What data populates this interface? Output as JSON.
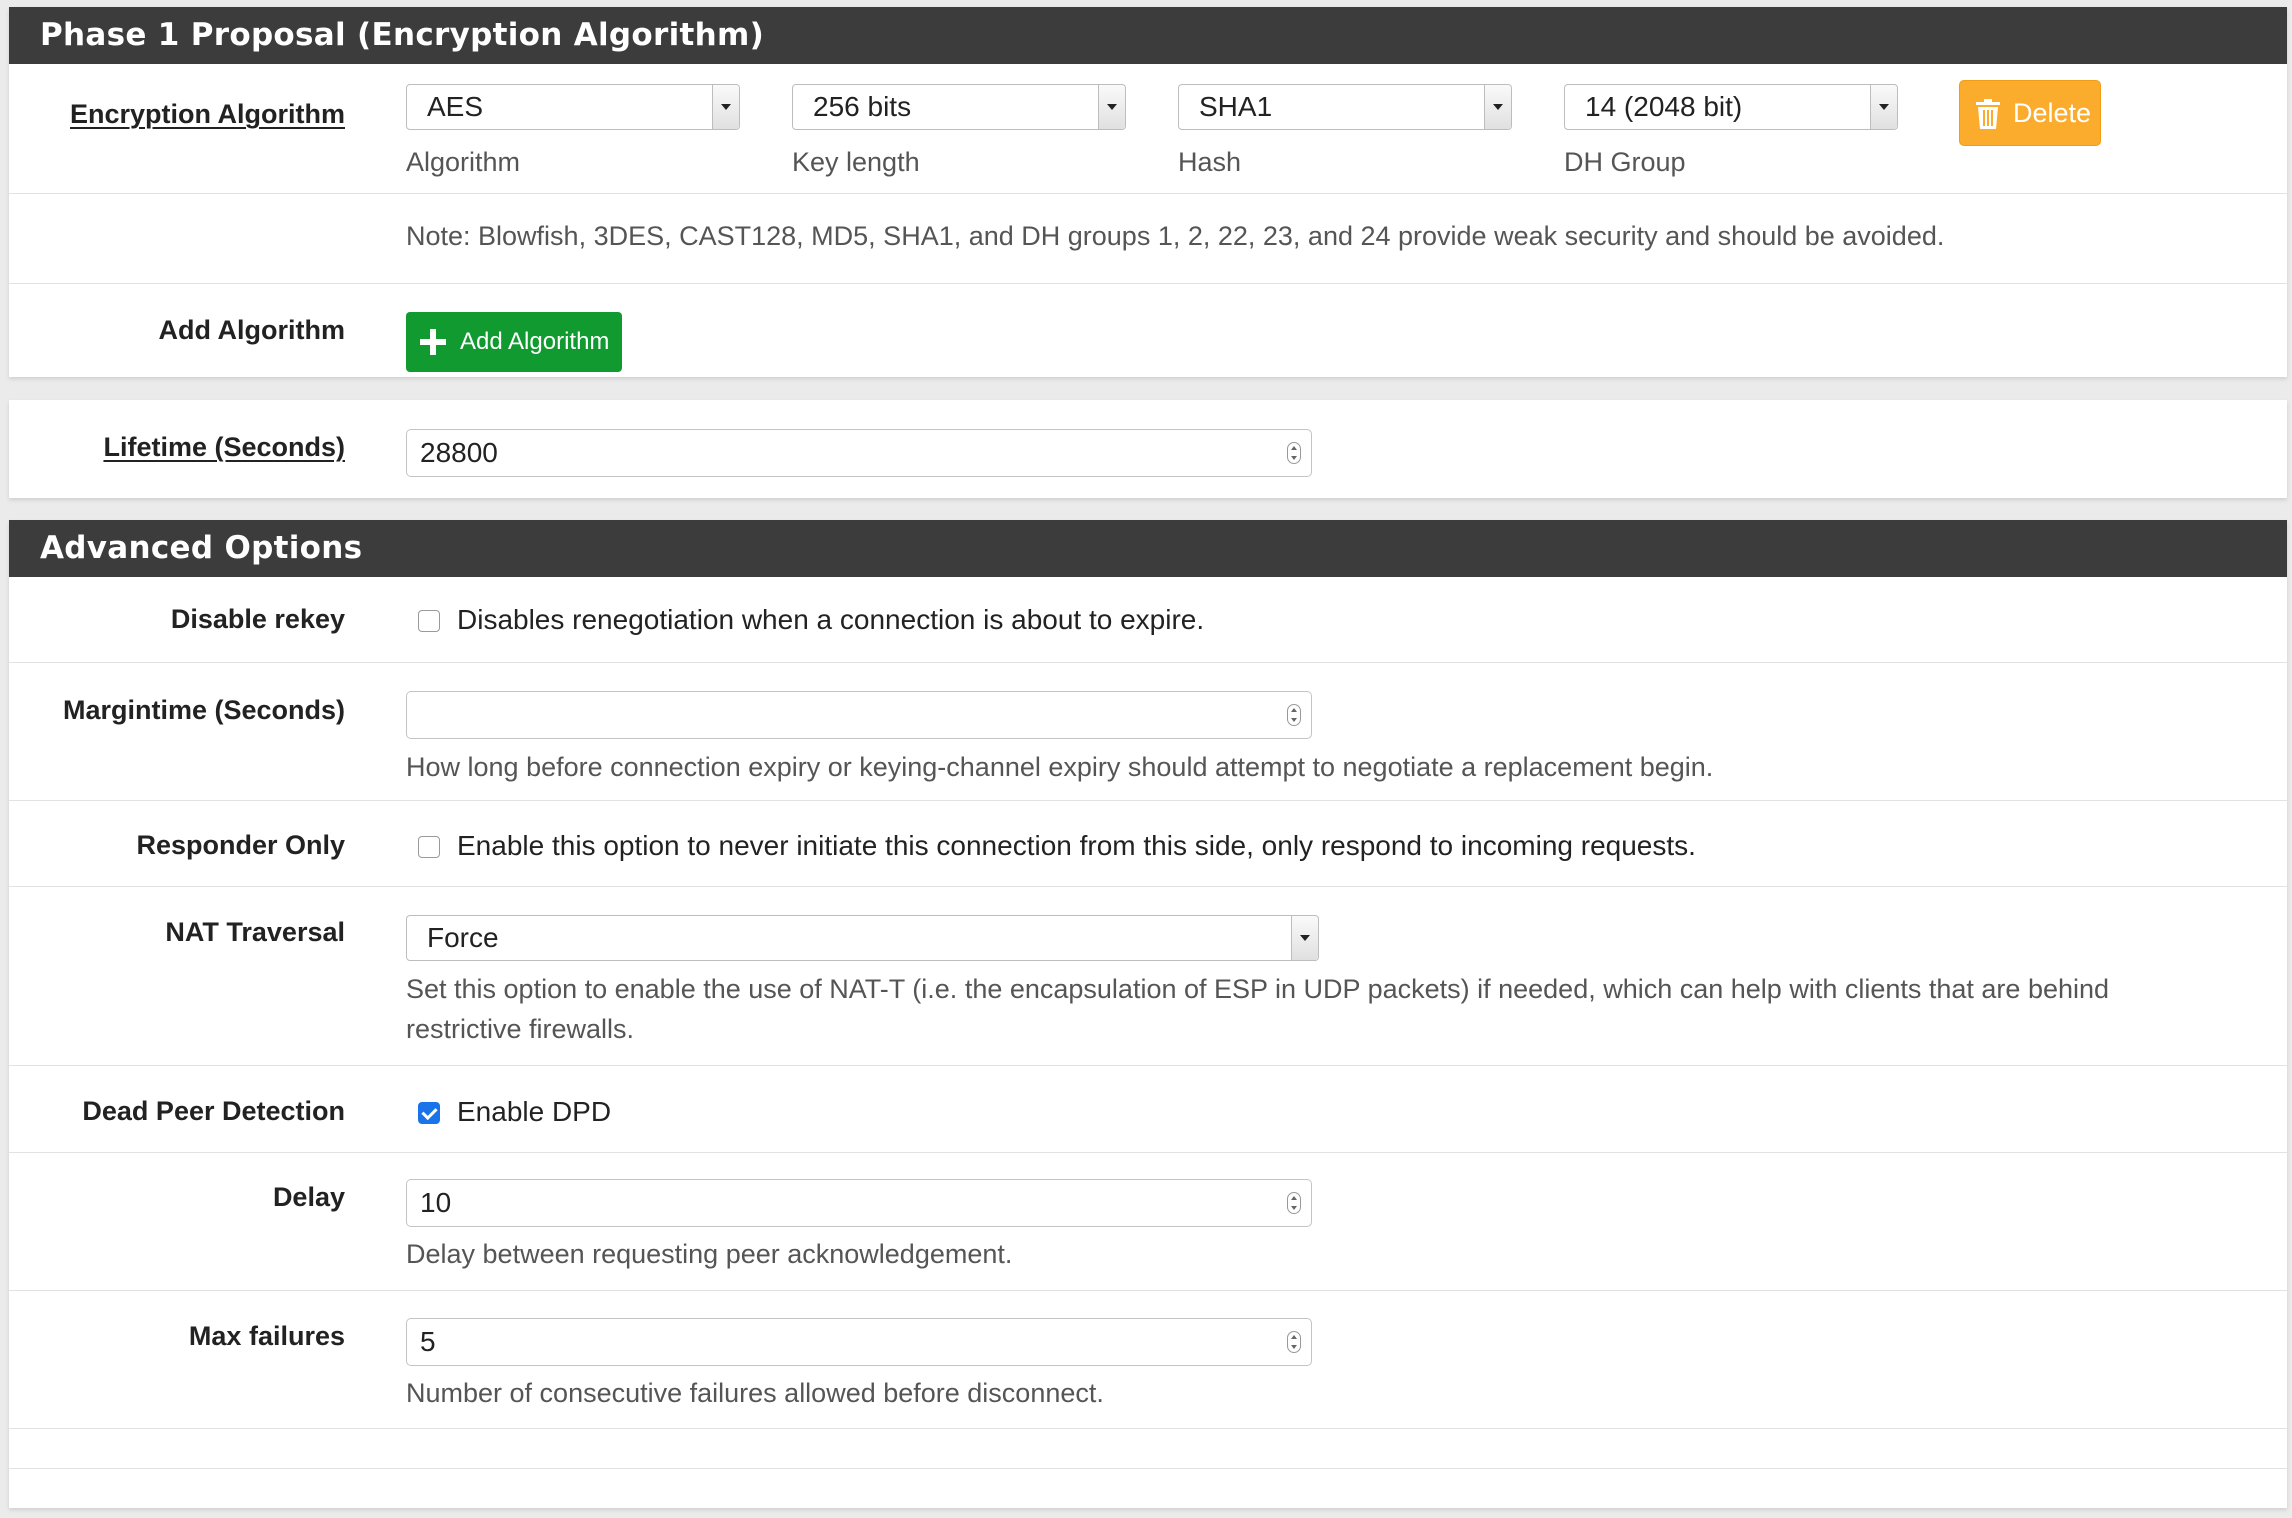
{
  "phase1": {
    "heading": "Phase 1 Proposal (Encryption Algorithm)",
    "encryption": {
      "label": "Encryption Algorithm",
      "algorithm": {
        "value": "AES",
        "caption": "Algorithm"
      },
      "key_length": {
        "value": "256 bits",
        "caption": "Key length"
      },
      "hash": {
        "value": "SHA1",
        "caption": "Hash"
      },
      "dh_group": {
        "value": "14 (2048 bit)",
        "caption": "DH Group"
      },
      "delete_label": "Delete"
    },
    "note": "Note: Blowfish, 3DES, CAST128, MD5, SHA1, and DH groups 1, 2, 22, 23, and 24 provide weak security and should be avoided.",
    "add": {
      "label": "Add Algorithm",
      "button_label": "Add Algorithm"
    }
  },
  "lifetime": {
    "label": "Lifetime (Seconds)",
    "value": "28800"
  },
  "advanced": {
    "heading": "Advanced Options",
    "disable_rekey": {
      "label": "Disable rekey",
      "checked": false,
      "text": "Disables renegotiation when a connection is about to expire."
    },
    "margintime": {
      "label": "Margintime (Seconds)",
      "value": "",
      "help": "How long before connection expiry or keying-channel expiry should attempt to negotiate a replacement begin."
    },
    "responder_only": {
      "label": "Responder Only",
      "checked": false,
      "text": "Enable this option to never initiate this connection from this side, only respond to incoming requests."
    },
    "nat_traversal": {
      "label": "NAT Traversal",
      "value": "Force",
      "help": "Set this option to enable the use of NAT-T (i.e. the encapsulation of ESP in UDP packets) if needed, which can help with clients that are behind restrictive firewalls."
    },
    "dpd": {
      "label": "Dead Peer Detection",
      "checked": true,
      "text": "Enable DPD"
    },
    "delay": {
      "label": "Delay",
      "value": "10",
      "help": "Delay between requesting peer acknowledgement."
    },
    "max_failures": {
      "label": "Max failures",
      "value": "5",
      "help": "Number of consecutive failures allowed before disconnect."
    }
  },
  "colors": {
    "heading_bg": "#3c3c3c",
    "delete_btn": "#fbac2c",
    "add_btn": "#109a2f",
    "checkbox_checked": "#1a73e8"
  }
}
